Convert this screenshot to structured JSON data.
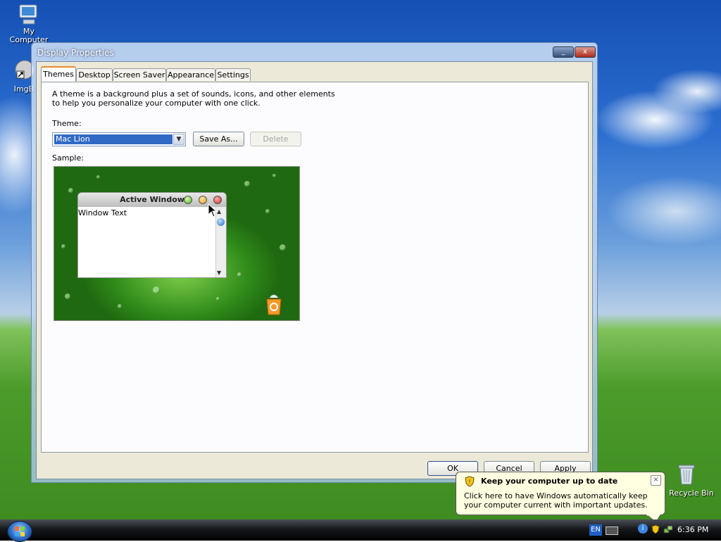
{
  "desktop": {
    "icons": [
      {
        "label": "My Computer"
      },
      {
        "label": "ImgB"
      },
      {
        "label": "Recycle Bin"
      }
    ]
  },
  "window": {
    "title": "Display Properties",
    "minimize_glyph": "_",
    "close_glyph": "x",
    "tabs": [
      {
        "label": "Themes"
      },
      {
        "label": "Desktop"
      },
      {
        "label": "Screen Saver"
      },
      {
        "label": "Appearance"
      },
      {
        "label": "Settings"
      }
    ],
    "active_tab": "Themes",
    "description_line1": "A theme is a background plus a set of sounds, icons, and other elements",
    "description_line2": "to help you personalize your computer with one click.",
    "theme_label": "Theme:",
    "theme_value": "Mac Lion",
    "save_as_label": "Save As...",
    "delete_label": "Delete",
    "sample_label": "Sample:",
    "sample_window_title": "Active Window",
    "sample_window_text": "Window Text",
    "ok_label": "OK",
    "cancel_label": "Cancel",
    "apply_label": "Apply"
  },
  "balloon": {
    "title": "Keep your computer up to date",
    "line1": "Click here to have Windows automatically keep",
    "line2": "your computer current with important updates."
  },
  "taskbar": {
    "language": "EN",
    "clock": "6:36 PM"
  },
  "colors": {
    "selection": "#316ac5",
    "active_tab_accent": "#e68b2c",
    "balloon_bg": "#ffffe1"
  }
}
